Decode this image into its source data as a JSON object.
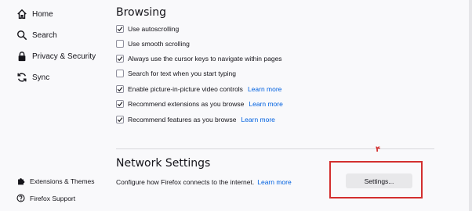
{
  "sidebar": {
    "items": [
      {
        "label": "Home",
        "icon": "home-icon"
      },
      {
        "label": "Search",
        "icon": "search-icon"
      },
      {
        "label": "Privacy & Security",
        "icon": "lock-icon"
      },
      {
        "label": "Sync",
        "icon": "sync-icon"
      }
    ],
    "footer": [
      {
        "label": "Extensions & Themes",
        "icon": "puzzle-icon"
      },
      {
        "label": "Firefox Support",
        "icon": "help-icon"
      }
    ]
  },
  "browsing": {
    "title": "Browsing",
    "options": [
      {
        "label": "Use autoscrolling",
        "checked": true,
        "link": ""
      },
      {
        "label": "Use smooth scrolling",
        "checked": false,
        "link": ""
      },
      {
        "label": "Always use the cursor keys to navigate within pages",
        "checked": true,
        "link": ""
      },
      {
        "label": "Search for text when you start typing",
        "checked": false,
        "link": ""
      },
      {
        "label": "Enable picture-in-picture video controls",
        "checked": true,
        "link": "Learn more"
      },
      {
        "label": "Recommend extensions as you browse",
        "checked": true,
        "link": "Learn more"
      },
      {
        "label": "Recommend features as you browse",
        "checked": true,
        "link": "Learn more"
      }
    ]
  },
  "network": {
    "title": "Network Settings",
    "description": "Configure how Firefox connects to the internet.",
    "link": "Learn more",
    "button": "Settings..."
  },
  "annotation": {
    "marker": "۴",
    "color": "#d32f2f"
  },
  "colors": {
    "link": "#0061e0",
    "checkbox_border": "#8f8f9d"
  }
}
